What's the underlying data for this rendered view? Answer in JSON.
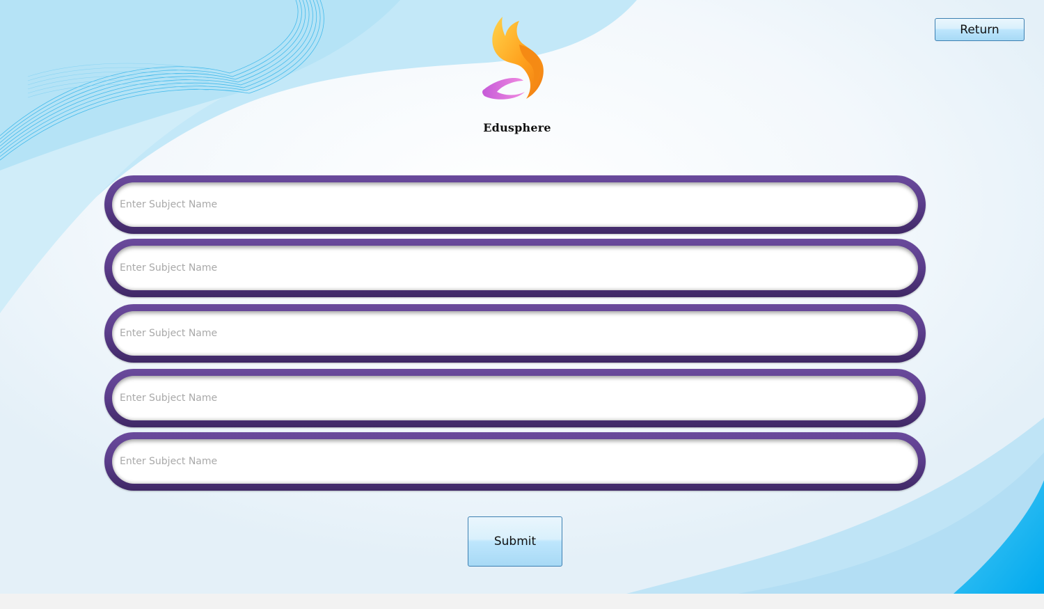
{
  "header": {
    "return_label": "Return"
  },
  "logo": {
    "brand_name": "Edusphere"
  },
  "form": {
    "fields": [
      {
        "placeholder": "Enter Subject Name",
        "value": ""
      },
      {
        "placeholder": "Enter Subject Name",
        "value": ""
      },
      {
        "placeholder": "Enter Subject Name",
        "value": ""
      },
      {
        "placeholder": "Enter Subject Name",
        "value": ""
      },
      {
        "placeholder": "Enter Subject Name",
        "value": ""
      }
    ],
    "submit_label": "Submit"
  },
  "colors": {
    "field_frame": "#5a3c8a",
    "button_border": "#3c7fb1",
    "background_wave": "#bfe6f7",
    "accent_blue": "#12b5f0"
  }
}
